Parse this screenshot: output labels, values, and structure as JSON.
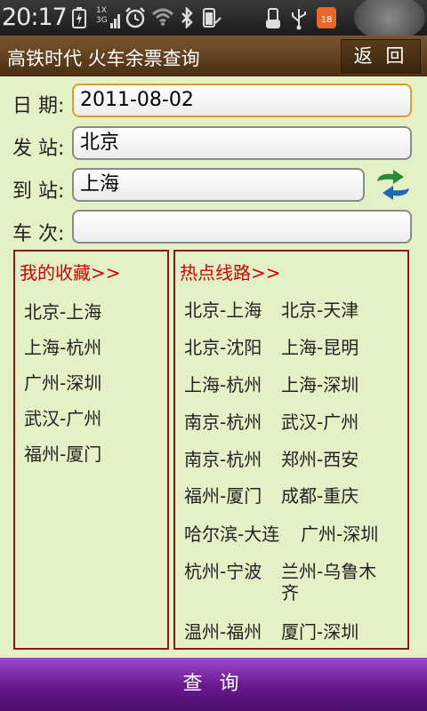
{
  "status_bar": {
    "time": "20:17",
    "network_top": "1X",
    "network_bottom": "3G",
    "notification_count": "18",
    "icons": [
      "battery-icon",
      "network-icon",
      "alarm-icon",
      "wifi-icon",
      "bluetooth-icon",
      "battery-status-icon",
      "usb-icon",
      "usb-debug-icon",
      "notification-icon"
    ]
  },
  "header": {
    "title": "高铁时代 火车余票查询",
    "back_label": "返 回"
  },
  "form": {
    "date_label": "日 期:",
    "date_value": "2011-08-02",
    "from_label": "发 站:",
    "from_value": "北京",
    "to_label": "到 站:",
    "to_value": "上海",
    "train_label": "车 次:",
    "train_value": ""
  },
  "favorites": {
    "title": "我的收藏>>",
    "items": [
      "北京-上海",
      "上海-杭州",
      "广州-深圳",
      "武汉-广州",
      "福州-厦门"
    ]
  },
  "hot_routes": {
    "title": "热点线路>>",
    "rows": [
      [
        "北京-上海",
        "北京-天津"
      ],
      [
        "北京-沈阳",
        "上海-昆明"
      ],
      [
        "上海-杭州",
        "上海-深圳"
      ],
      [
        "南京-杭州",
        "武汉-广州"
      ],
      [
        "南京-杭州",
        "郑州-西安"
      ],
      [
        "福州-厦门",
        "成都-重庆"
      ],
      [
        "哈尔滨-大连",
        "广州-深圳"
      ],
      [
        "杭州-宁波",
        "兰州-乌鲁木齐"
      ],
      [
        "温州-福州",
        "厦门-深圳"
      ]
    ]
  },
  "footer": {
    "query_label": "查 询"
  },
  "colors": {
    "accent_red": "#d20000",
    "title_bar": "#5a3c1b",
    "bottom_bar": "#7b249f",
    "focus_border": "#e89a28"
  }
}
